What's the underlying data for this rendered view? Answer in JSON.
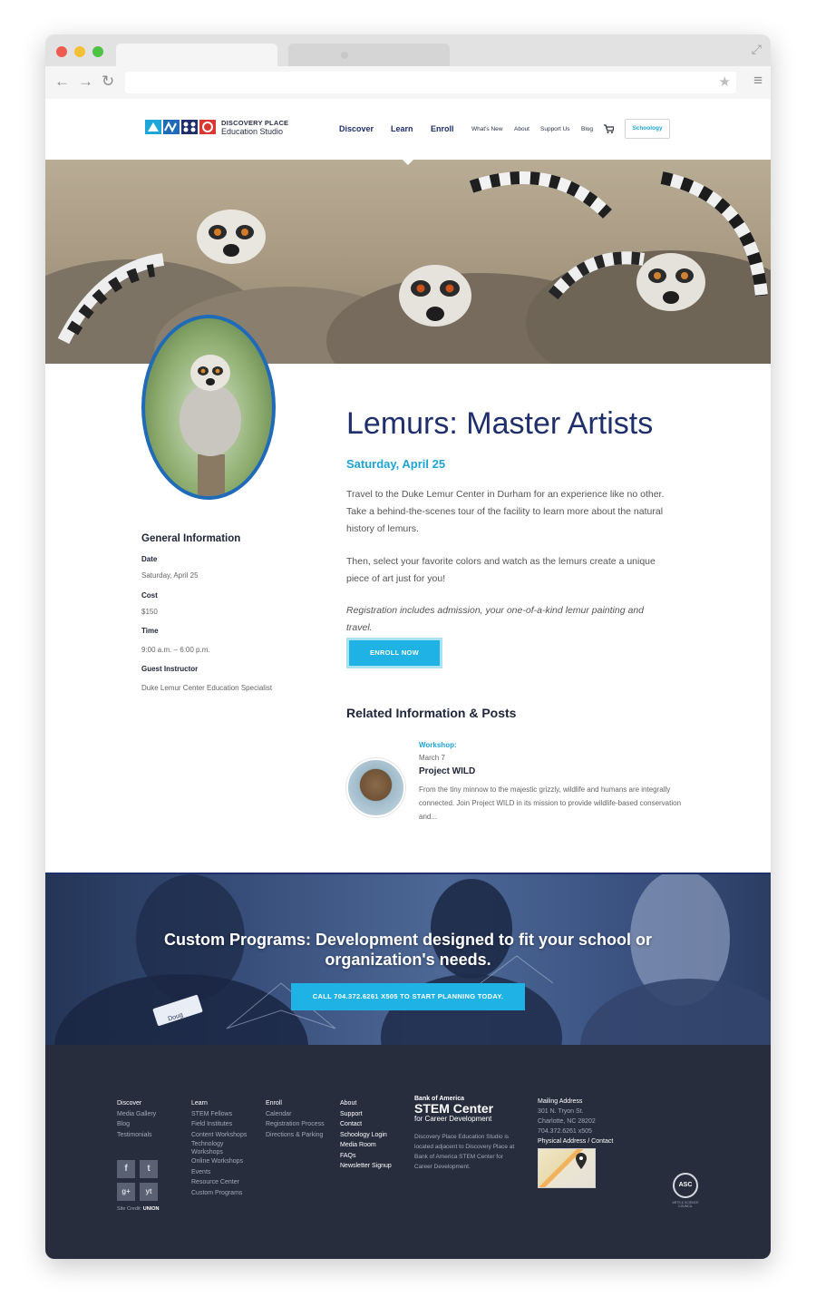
{
  "site": {
    "logo_line1": "DISCOVERY PLACE",
    "logo_line2": "Education Studio",
    "main_nav": [
      "Discover",
      "Learn",
      "Enroll"
    ],
    "sub_nav": [
      "What's New",
      "About",
      "Support Us",
      "Blog"
    ],
    "schoology_label": "Schoology"
  },
  "event": {
    "title": "Lemurs: Master Artists",
    "date_heading": "Saturday, April 25",
    "paragraph1": "Travel to the Duke Lemur Center in Durham for an experience like no other. Take a behind-the-scenes tour of the facility to learn more about the natural history of lemurs.",
    "paragraph2": "Then, select your favorite colors and watch as the lemurs create a unique piece of art just for you!",
    "paragraph3": "Registration includes admission, your one-of-a-kind lemur painting and travel.",
    "enroll_label": "ENROLL NOW"
  },
  "general_info": {
    "heading": "General Information",
    "date_label": "Date",
    "date_value": "Saturday, April 25",
    "cost_label": "Cost",
    "cost_value": "$150",
    "time_label": "Time",
    "time_value": "9:00 a.m. – 6:00 p.m.",
    "instructor_label": "Guest Instructor",
    "instructor_value": "Duke Lemur Center Education Specialist"
  },
  "related": {
    "heading": "Related Information & Posts",
    "category": "Workshop:",
    "date": "March 7",
    "title": "Project WILD",
    "text": "From the tiny minnow to the majestic grizzly, wildlife and humans are integrally connected. Join Project WILD in its mission to provide wildlife-based conservation and..."
  },
  "banner": {
    "title_line1": "Custom Programs: Development designed to fit your school or",
    "title_line2": "organization's needs.",
    "button_label": "CALL 704.372.6261 X505 TO START PLANNING TODAY.",
    "badge_name": "Doug"
  },
  "footer": {
    "col_discover": [
      "Discover",
      "Media Gallery",
      "Blog",
      "Testimonials"
    ],
    "col_learn": [
      "Learn",
      "STEM Fellows",
      "Field Institutes",
      "Content Workshops",
      "Technology",
      "Workshops",
      "Online Workshops",
      "Events",
      "Resource Center",
      "Custom Programs"
    ],
    "col_enroll": [
      "Enroll",
      "Calendar",
      "Registration Process",
      "Directions & Parking"
    ],
    "col_about": [
      "About",
      "Support",
      "Contact",
      "Schoology Login",
      "Media Room",
      "FAQs",
      "Newsletter Signup"
    ],
    "boa_small": "Bank of America",
    "boa_big": "STEM Center",
    "boa_sub": "for Career Development",
    "boa_text": "Discovery Place Education Studio is located adjacent to Discovery Place at Bank of America STEM Center for Career Development.",
    "address_heading": "Mailing Address",
    "address_lines": [
      "301 N. Tryon St.",
      "Charlotte, NC 28202",
      "704.372.6261 x505"
    ],
    "address_link1": "Physical Address",
    "address_sep": " / ",
    "address_link2": "Contact",
    "social": [
      "f",
      "t",
      "g+",
      "yt"
    ],
    "credit": "Site Credit:",
    "credit_brand": "UNION",
    "asc_label": "ASC",
    "asc_sub": "ARTS & SCIENCE COUNCIL"
  }
}
